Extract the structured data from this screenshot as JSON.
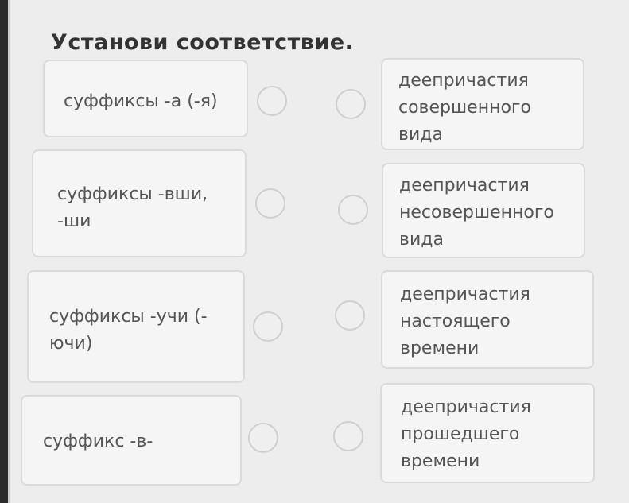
{
  "title": "Установи соответствие.",
  "left_items": [
    {
      "lines": [
        "суффиксы -а (-я)"
      ]
    },
    {
      "lines": [
        "суффиксы -вши,",
        "-ши"
      ]
    },
    {
      "lines": [
        "суффиксы -учи (-",
        "ючи)"
      ]
    },
    {
      "lines": [
        "суффикс -в-"
      ]
    }
  ],
  "right_items": [
    {
      "lines": [
        "деепричастия",
        "совершенного",
        "вида"
      ]
    },
    {
      "lines": [
        "деепричастия",
        "несовершенного",
        "вида"
      ]
    },
    {
      "lines": [
        "деепричастия",
        "настоящего",
        "времени"
      ]
    },
    {
      "lines": [
        "деепричастия",
        "прошедшего",
        "времени"
      ]
    }
  ]
}
